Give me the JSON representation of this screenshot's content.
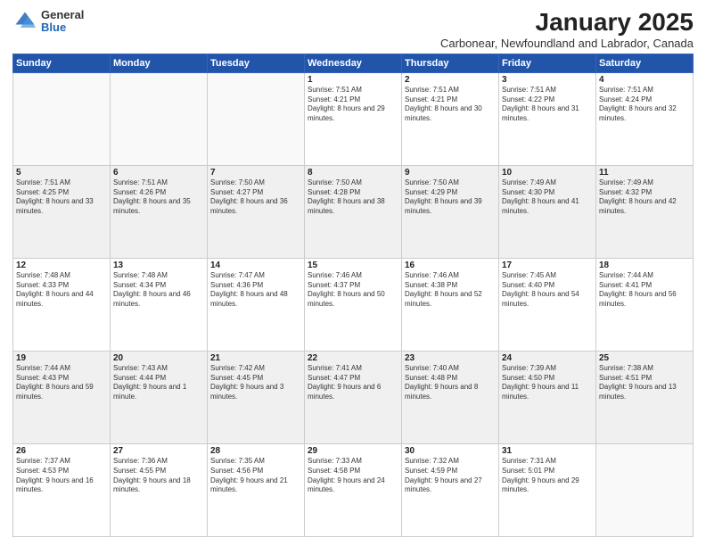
{
  "logo": {
    "general": "General",
    "blue": "Blue"
  },
  "header": {
    "title": "January 2025",
    "subtitle": "Carbonear, Newfoundland and Labrador, Canada"
  },
  "weekdays": [
    "Sunday",
    "Monday",
    "Tuesday",
    "Wednesday",
    "Thursday",
    "Friday",
    "Saturday"
  ],
  "weeks": [
    [
      {
        "day": "",
        "info": ""
      },
      {
        "day": "",
        "info": ""
      },
      {
        "day": "",
        "info": ""
      },
      {
        "day": "1",
        "info": "Sunrise: 7:51 AM\nSunset: 4:21 PM\nDaylight: 8 hours and 29 minutes."
      },
      {
        "day": "2",
        "info": "Sunrise: 7:51 AM\nSunset: 4:21 PM\nDaylight: 8 hours and 30 minutes."
      },
      {
        "day": "3",
        "info": "Sunrise: 7:51 AM\nSunset: 4:22 PM\nDaylight: 8 hours and 31 minutes."
      },
      {
        "day": "4",
        "info": "Sunrise: 7:51 AM\nSunset: 4:24 PM\nDaylight: 8 hours and 32 minutes."
      }
    ],
    [
      {
        "day": "5",
        "info": "Sunrise: 7:51 AM\nSunset: 4:25 PM\nDaylight: 8 hours and 33 minutes."
      },
      {
        "day": "6",
        "info": "Sunrise: 7:51 AM\nSunset: 4:26 PM\nDaylight: 8 hours and 35 minutes."
      },
      {
        "day": "7",
        "info": "Sunrise: 7:50 AM\nSunset: 4:27 PM\nDaylight: 8 hours and 36 minutes."
      },
      {
        "day": "8",
        "info": "Sunrise: 7:50 AM\nSunset: 4:28 PM\nDaylight: 8 hours and 38 minutes."
      },
      {
        "day": "9",
        "info": "Sunrise: 7:50 AM\nSunset: 4:29 PM\nDaylight: 8 hours and 39 minutes."
      },
      {
        "day": "10",
        "info": "Sunrise: 7:49 AM\nSunset: 4:30 PM\nDaylight: 8 hours and 41 minutes."
      },
      {
        "day": "11",
        "info": "Sunrise: 7:49 AM\nSunset: 4:32 PM\nDaylight: 8 hours and 42 minutes."
      }
    ],
    [
      {
        "day": "12",
        "info": "Sunrise: 7:48 AM\nSunset: 4:33 PM\nDaylight: 8 hours and 44 minutes."
      },
      {
        "day": "13",
        "info": "Sunrise: 7:48 AM\nSunset: 4:34 PM\nDaylight: 8 hours and 46 minutes."
      },
      {
        "day": "14",
        "info": "Sunrise: 7:47 AM\nSunset: 4:36 PM\nDaylight: 8 hours and 48 minutes."
      },
      {
        "day": "15",
        "info": "Sunrise: 7:46 AM\nSunset: 4:37 PM\nDaylight: 8 hours and 50 minutes."
      },
      {
        "day": "16",
        "info": "Sunrise: 7:46 AM\nSunset: 4:38 PM\nDaylight: 8 hours and 52 minutes."
      },
      {
        "day": "17",
        "info": "Sunrise: 7:45 AM\nSunset: 4:40 PM\nDaylight: 8 hours and 54 minutes."
      },
      {
        "day": "18",
        "info": "Sunrise: 7:44 AM\nSunset: 4:41 PM\nDaylight: 8 hours and 56 minutes."
      }
    ],
    [
      {
        "day": "19",
        "info": "Sunrise: 7:44 AM\nSunset: 4:43 PM\nDaylight: 8 hours and 59 minutes."
      },
      {
        "day": "20",
        "info": "Sunrise: 7:43 AM\nSunset: 4:44 PM\nDaylight: 9 hours and 1 minute."
      },
      {
        "day": "21",
        "info": "Sunrise: 7:42 AM\nSunset: 4:45 PM\nDaylight: 9 hours and 3 minutes."
      },
      {
        "day": "22",
        "info": "Sunrise: 7:41 AM\nSunset: 4:47 PM\nDaylight: 9 hours and 6 minutes."
      },
      {
        "day": "23",
        "info": "Sunrise: 7:40 AM\nSunset: 4:48 PM\nDaylight: 9 hours and 8 minutes."
      },
      {
        "day": "24",
        "info": "Sunrise: 7:39 AM\nSunset: 4:50 PM\nDaylight: 9 hours and 11 minutes."
      },
      {
        "day": "25",
        "info": "Sunrise: 7:38 AM\nSunset: 4:51 PM\nDaylight: 9 hours and 13 minutes."
      }
    ],
    [
      {
        "day": "26",
        "info": "Sunrise: 7:37 AM\nSunset: 4:53 PM\nDaylight: 9 hours and 16 minutes."
      },
      {
        "day": "27",
        "info": "Sunrise: 7:36 AM\nSunset: 4:55 PM\nDaylight: 9 hours and 18 minutes."
      },
      {
        "day": "28",
        "info": "Sunrise: 7:35 AM\nSunset: 4:56 PM\nDaylight: 9 hours and 21 minutes."
      },
      {
        "day": "29",
        "info": "Sunrise: 7:33 AM\nSunset: 4:58 PM\nDaylight: 9 hours and 24 minutes."
      },
      {
        "day": "30",
        "info": "Sunrise: 7:32 AM\nSunset: 4:59 PM\nDaylight: 9 hours and 27 minutes."
      },
      {
        "day": "31",
        "info": "Sunrise: 7:31 AM\nSunset: 5:01 PM\nDaylight: 9 hours and 29 minutes."
      },
      {
        "day": "",
        "info": ""
      }
    ]
  ]
}
